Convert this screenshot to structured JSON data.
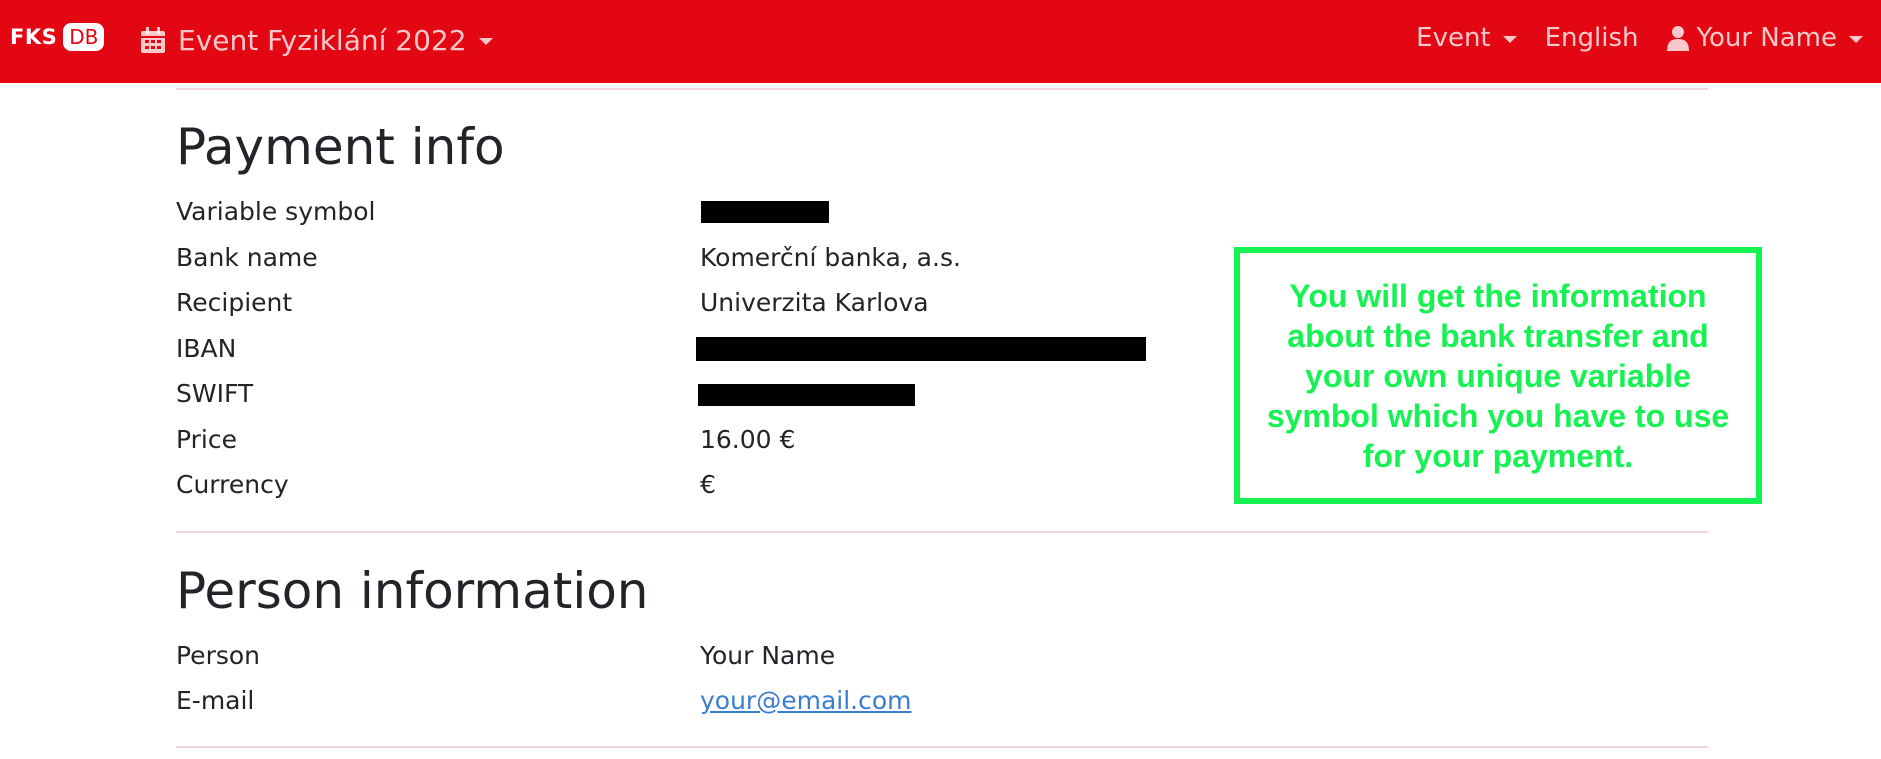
{
  "navbar": {
    "brand_left": "FKS",
    "brand_right": "DB",
    "event_title": "Event Fyziklání 2022",
    "event_menu_label": "Event",
    "language_label": "English",
    "user_label": "Your Name",
    "background_color": "#e30613"
  },
  "payment": {
    "title": "Payment info",
    "rows": [
      {
        "label": "Variable symbol",
        "value": ""
      },
      {
        "label": "Bank name",
        "value": "Komerční banka, a.s."
      },
      {
        "label": "Recipient",
        "value": "Univerzita Karlova"
      },
      {
        "label": "IBAN",
        "value": ""
      },
      {
        "label": "SWIFT",
        "value": ""
      },
      {
        "label": "Price",
        "value": "16.00 €"
      },
      {
        "label": "Currency",
        "value": "€"
      }
    ]
  },
  "person": {
    "title": "Person information",
    "rows": [
      {
        "label": "Person",
        "value": "Your Name"
      },
      {
        "label": "E-mail",
        "value": "your@email.com"
      }
    ]
  },
  "callout": {
    "text": "You will get the information about the bank transfer and your own unique variable symbol which you have to use for your payment.",
    "color": "#17f253"
  }
}
